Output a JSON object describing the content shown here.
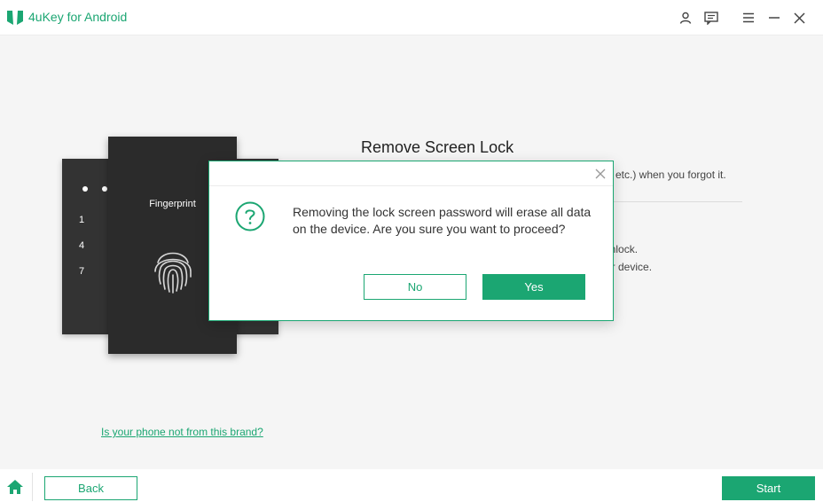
{
  "app": {
    "title": "4uKey for Android",
    "accent_color": "#1ba672"
  },
  "titlebar": {
    "icons": [
      "user-icon",
      "feedback-icon",
      "menu-icon",
      "minimize-icon",
      "close-icon"
    ]
  },
  "phones": {
    "pin_numbers": [
      "1",
      "4",
      "7"
    ],
    "fingerprint_label": "Fingerprint"
  },
  "content": {
    "section_title": "Remove Screen Lock",
    "desc_line_1": "etc.) when you forgot it.",
    "desc_line_2": "unlock.",
    "desc_line_3": "ur device.",
    "brand_link": "Is your phone not from this brand?"
  },
  "dialog": {
    "icon": "question-circle-icon",
    "message": "Removing the lock screen password will erase all data on the device. Are you sure you want to proceed?",
    "no_label": "No",
    "yes_label": "Yes"
  },
  "bottombar": {
    "back_label": "Back",
    "start_label": "Start"
  }
}
